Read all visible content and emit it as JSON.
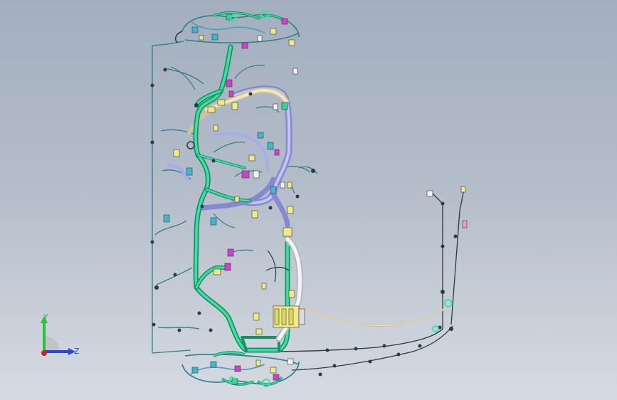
{
  "viewport": {
    "background_top": "#a3afbf",
    "background_bottom": "#d6dbe2"
  },
  "triad": {
    "y_label": "Y",
    "z_label": "Z",
    "y_color": "#2fbf3a",
    "z_color": "#2a46d8",
    "x_color": "#d02020"
  },
  "colors": {
    "harness_green": "#2fd49a",
    "harness_green_dark": "#1c8f64",
    "harness_lavender": "#9b9ee0",
    "harness_tan": "#e6ddb4",
    "wire_teal": "#2e7f86",
    "wire_dark": "#2d3a40",
    "connector_yellow": "#f0ea86",
    "connector_magenta": "#d040c8",
    "connector_cyan": "#3fb7d0",
    "connector_white": "#f2f2f2"
  }
}
